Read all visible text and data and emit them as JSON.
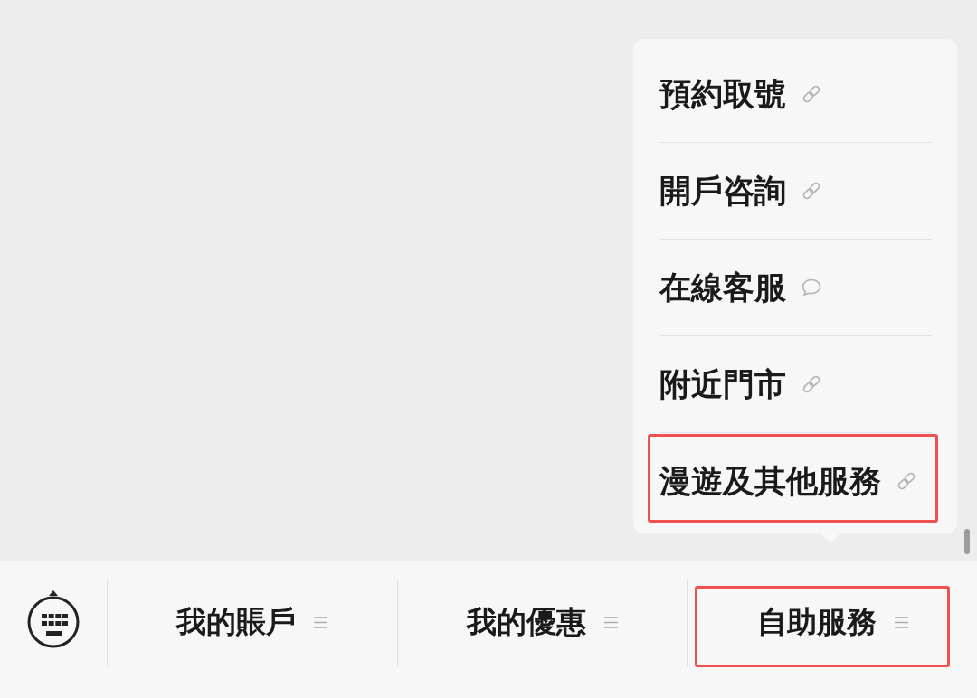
{
  "menu": {
    "items": [
      {
        "label": "預約取號",
        "kind": "link",
        "highlighted": false
      },
      {
        "label": "開戶咨詢",
        "kind": "link",
        "highlighted": false
      },
      {
        "label": "在線客服",
        "kind": "chat",
        "highlighted": false
      },
      {
        "label": "附近門市",
        "kind": "link",
        "highlighted": false
      },
      {
        "label": "漫遊及其他服務",
        "kind": "link",
        "highlighted": true
      }
    ]
  },
  "tab_bar": {
    "tabs": [
      {
        "label": "我的賬戶",
        "highlighted": false
      },
      {
        "label": "我的優惠",
        "highlighted": false
      },
      {
        "label": "自助服務",
        "highlighted": true
      }
    ]
  }
}
